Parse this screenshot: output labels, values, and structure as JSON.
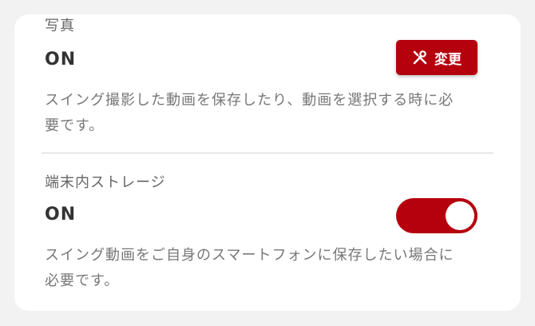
{
  "photo": {
    "label": "写真",
    "value": "ON",
    "change_button_label": "変更",
    "change_button_icon": "tools-icon",
    "description": "スイング撮影した動画を保存したり、動画を選択する時に必要です。"
  },
  "storage": {
    "label": "端末内ストレージ",
    "value": "ON",
    "toggle_state": "on",
    "description": "スイング動画をご自身のスマートフォンに保存したい場合に必要です。"
  },
  "colors": {
    "accent": "#b5000e",
    "background": "#f2f2f2",
    "card": "#ffffff"
  }
}
